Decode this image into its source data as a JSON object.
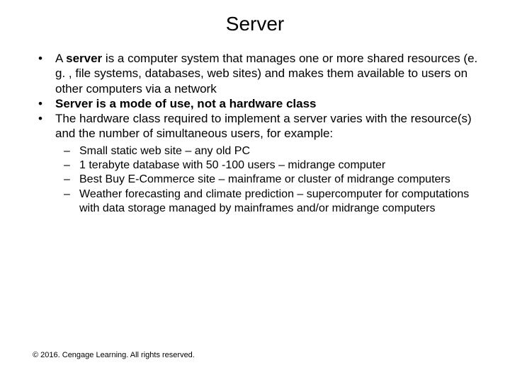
{
  "title": "Server",
  "bullets": {
    "b1_pre": "A ",
    "b1_bold": "server",
    "b1_post": " is a computer system that manages one or more shared resources (e. g. , file systems, databases, web sites) and makes them available to users on other computers via a network",
    "b2": "Server is a mode of use, not a hardware class",
    "b3": "The hardware class required to implement a server varies with the resource(s) and the number of simultaneous users, for example:"
  },
  "sub": {
    "s1": "Small static web site – any old PC",
    "s2": "1 terabyte database with 50 -100 users – midrange computer",
    "s3": "Best Buy E-Commerce site – mainframe or cluster of midrange computers",
    "s4": "Weather forecasting and climate prediction – supercomputer for computations with data storage managed by mainframes and/or midrange computers"
  },
  "footer": "© 2016. Cengage Learning. All rights reserved."
}
